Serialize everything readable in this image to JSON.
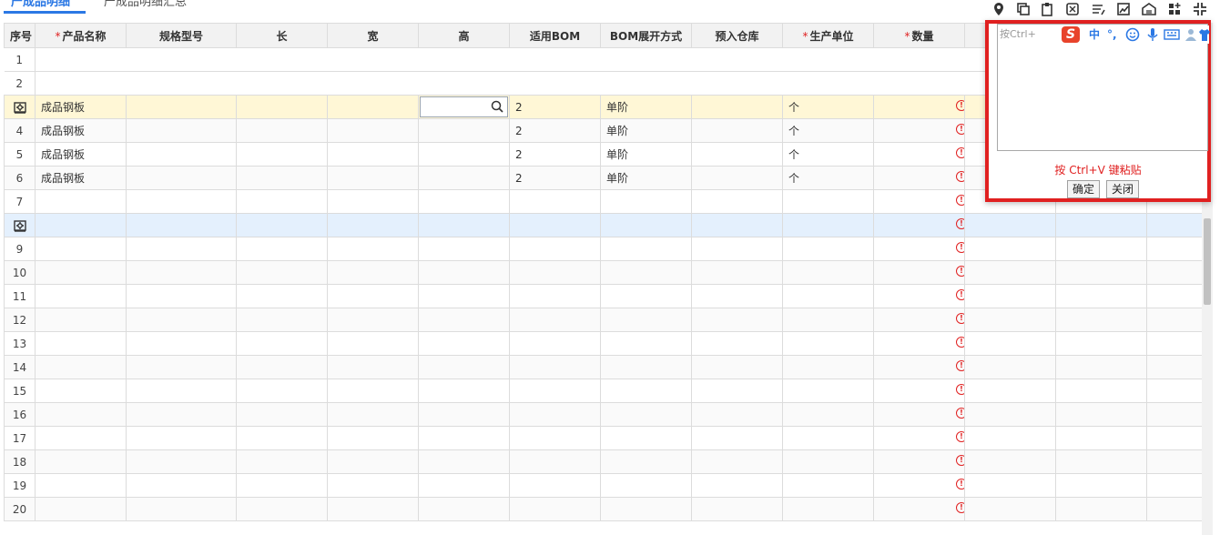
{
  "tabs": {
    "active": "产成品明细",
    "inactive": "产成品明细汇总"
  },
  "columns": [
    {
      "label": "序号",
      "required": false
    },
    {
      "label": "产品名称",
      "required": true
    },
    {
      "label": "规格型号",
      "required": false
    },
    {
      "label": "长",
      "required": false
    },
    {
      "label": "宽",
      "required": false
    },
    {
      "label": "高",
      "required": false
    },
    {
      "label": "适用BOM",
      "required": false
    },
    {
      "label": "BOM展开方式",
      "required": false
    },
    {
      "label": "预入仓库",
      "required": false
    },
    {
      "label": "生产单位",
      "required": true
    },
    {
      "label": "数量",
      "required": true
    }
  ],
  "rows": [
    {
      "seq": "1",
      "product": "",
      "bom": "",
      "bom_mode": "",
      "unit": ""
    },
    {
      "seq": "2",
      "product": "",
      "bom": "",
      "bom_mode": "",
      "unit": ""
    },
    {
      "seq": "",
      "product": "成品钢板",
      "bom": "2",
      "bom_mode": "单阶",
      "unit": "个"
    },
    {
      "seq": "4",
      "product": "成品钢板",
      "bom": "2",
      "bom_mode": "单阶",
      "unit": "个"
    },
    {
      "seq": "5",
      "product": "成品钢板",
      "bom": "2",
      "bom_mode": "单阶",
      "unit": "个"
    },
    {
      "seq": "6",
      "product": "成品钢板",
      "bom": "2",
      "bom_mode": "单阶",
      "unit": "个"
    },
    {
      "seq": "7",
      "product": "",
      "bom": "",
      "bom_mode": "",
      "unit": ""
    },
    {
      "seq": "",
      "product": "",
      "bom": "",
      "bom_mode": "",
      "unit": ""
    },
    {
      "seq": "9"
    },
    {
      "seq": "10"
    },
    {
      "seq": "11"
    },
    {
      "seq": "12"
    },
    {
      "seq": "13"
    },
    {
      "seq": "14"
    },
    {
      "seq": "15"
    },
    {
      "seq": "16"
    },
    {
      "seq": "17"
    },
    {
      "seq": "18"
    },
    {
      "seq": "19"
    },
    {
      "seq": "20"
    }
  ],
  "ime": {
    "placeholder": "按Ctrl+",
    "brand_char": "S",
    "mode_char": "中",
    "punct": "°,",
    "hint": "按 Ctrl+V 键粘贴",
    "confirm_label": "确定",
    "close_label": "关闭"
  },
  "icons": {
    "toolbar": [
      "location-icon",
      "copy-icon",
      "paste-icon",
      "calculator-icon",
      "pen-icon",
      "chart-icon",
      "warehouse-icon",
      "grid-add-icon",
      "shrink-icon"
    ],
    "row_settings": "gear-icon",
    "warning": "warning-circle-icon",
    "lookup": "magnifier-icon"
  },
  "colors": {
    "accent": "#2b78e4",
    "required": "#e02020",
    "row_selected": "#fff7d6",
    "row_hover": "#e4f0fd",
    "popup_border": "#e02020"
  }
}
